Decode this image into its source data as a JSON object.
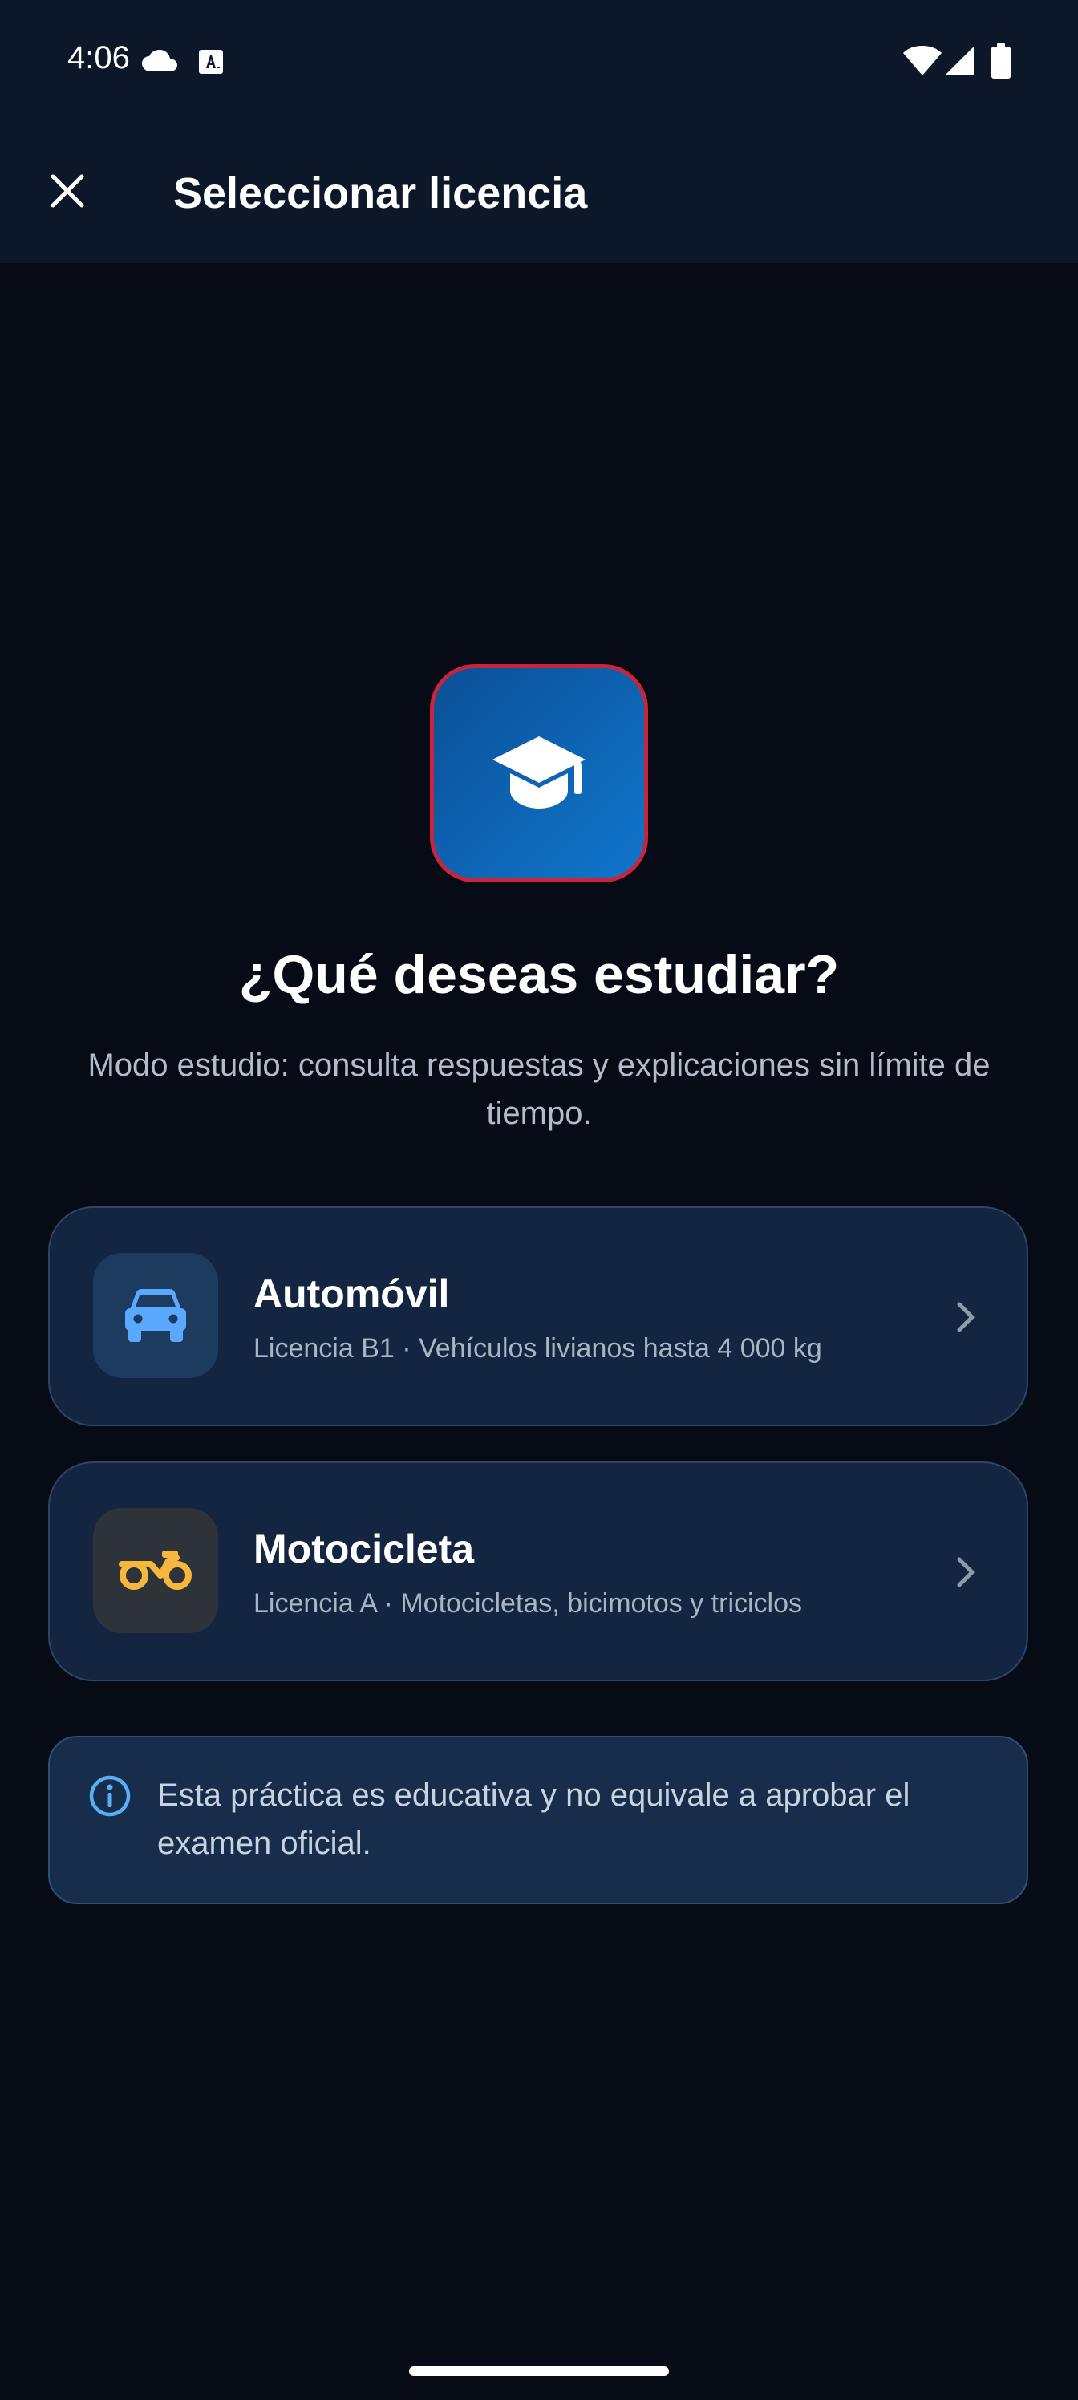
{
  "status_bar": {
    "time": "4:06",
    "icons": [
      "cloud-icon",
      "font-a-icon",
      "wifi-icon",
      "signal-icon",
      "battery-icon"
    ]
  },
  "app_bar": {
    "title": "Seleccionar licencia",
    "close_icon": "close-icon"
  },
  "hero": {
    "icon": "graduation-cap-icon",
    "heading": "¿Qué deseas estudiar?",
    "subheading": "Modo estudio: consulta respuestas y explicaciones sin límite de tiempo."
  },
  "licenses": [
    {
      "title": "Automóvil",
      "subtitle": "Licencia B1 · Vehículos livianos hasta 4 000 kg",
      "icon": "car-icon",
      "icon_color": "#5aa9ff"
    },
    {
      "title": "Motocicleta",
      "subtitle": "Licencia A · Motocicletas, bicimotos y triciclos",
      "icon": "motorcycle-icon",
      "icon_color": "#f6b73c"
    }
  ],
  "info": {
    "icon": "info-icon",
    "text": "Esta práctica es educativa y no equivale a aprobar el examen oficial."
  },
  "colors": {
    "background": "#060b16",
    "app_bar": "#0c1829",
    "card": "#132540",
    "accent_blue": "#1176cc",
    "accent_border": "#c8243c"
  }
}
